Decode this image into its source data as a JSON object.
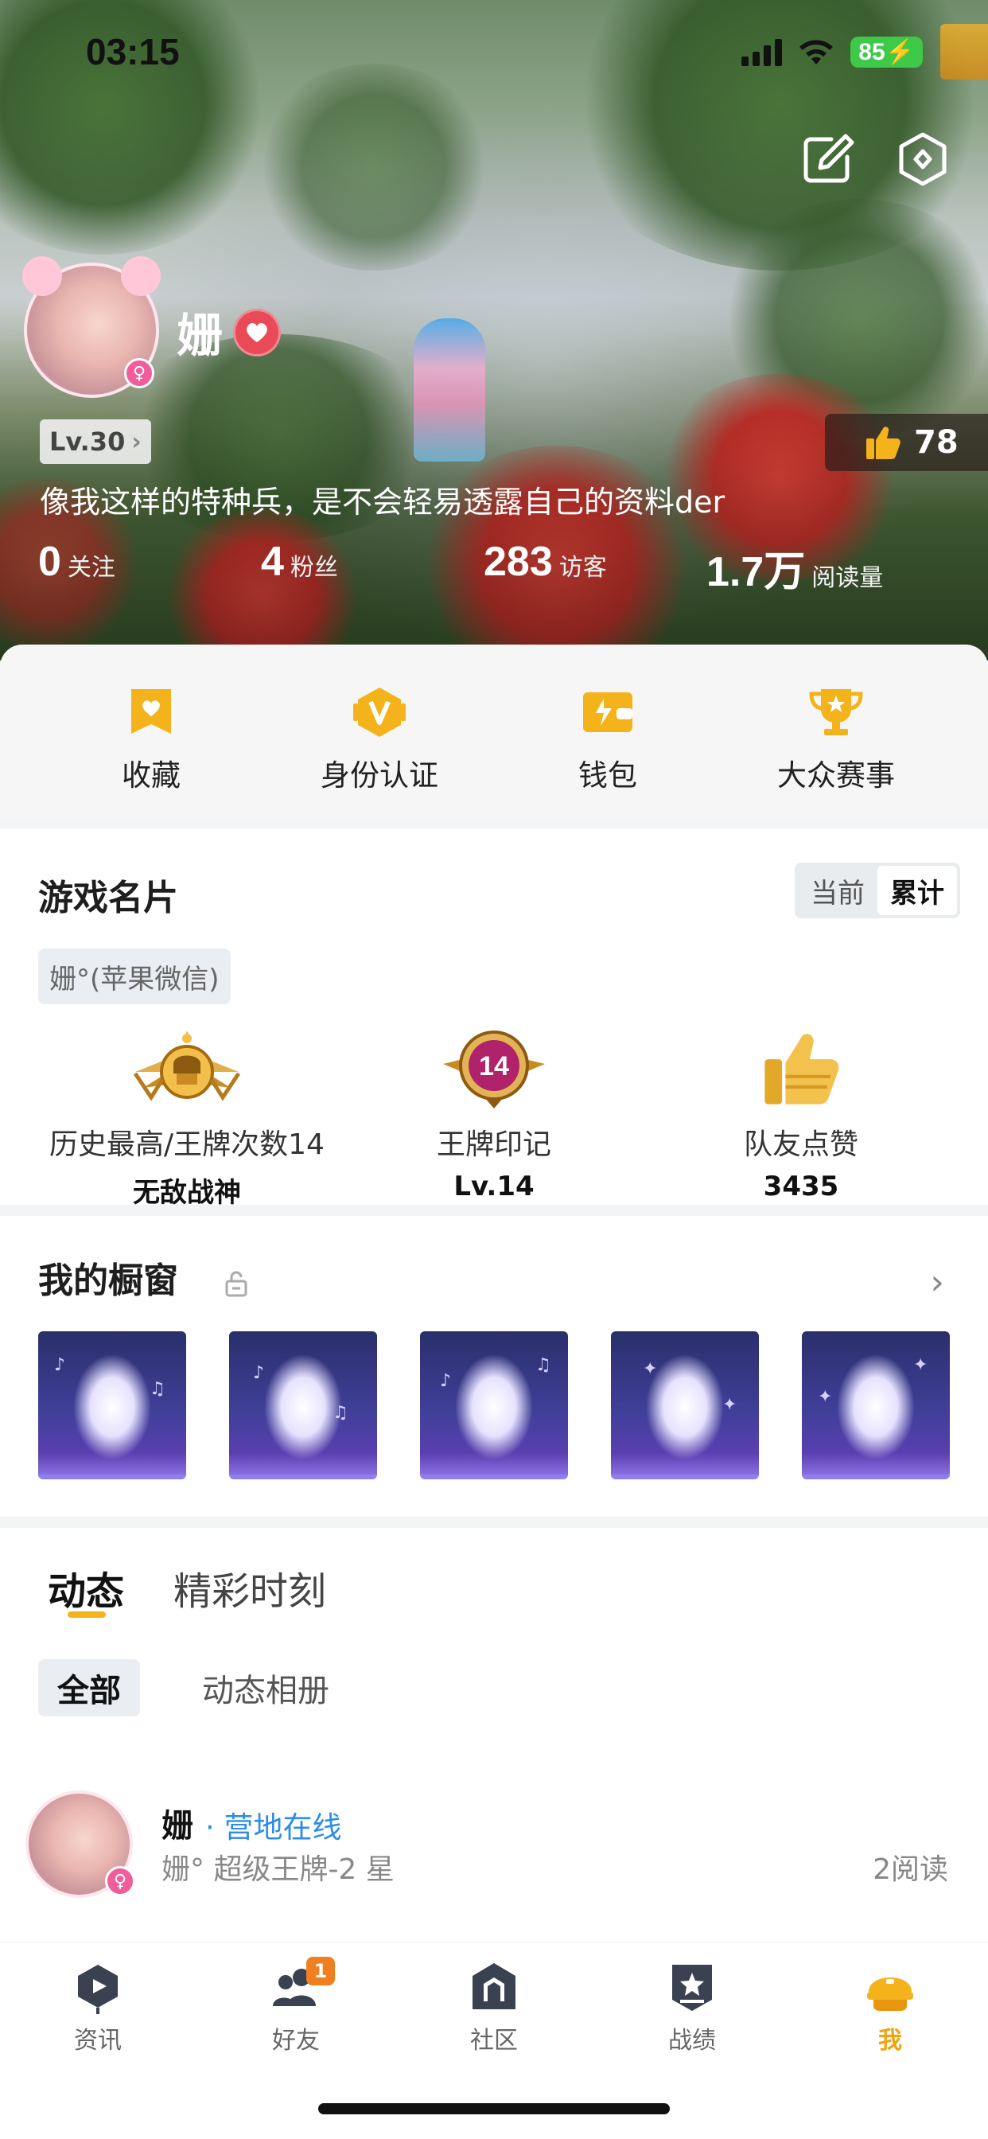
{
  "status_bar": {
    "time": "03:15",
    "battery": "85"
  },
  "profile": {
    "nickname": "姗",
    "gender_symbol": "♀",
    "level": "Lv.30",
    "likes": "78",
    "bio": "像我这样的特种兵，是不会轻易透露自己的资料der",
    "stats": [
      {
        "value": "0",
        "label": "关注"
      },
      {
        "value": "4",
        "label": "粉丝"
      },
      {
        "value": "283",
        "label": "访客"
      },
      {
        "value": "1.7万",
        "label": "阅读量"
      }
    ]
  },
  "quick_menu": [
    {
      "label": "收藏",
      "icon": "bookmark-icon"
    },
    {
      "label": "身份认证",
      "icon": "verify-icon"
    },
    {
      "label": "钱包",
      "icon": "wallet-icon"
    },
    {
      "label": "大众赛事",
      "icon": "trophy-icon"
    }
  ],
  "game_card": {
    "title": "游戏名片",
    "toggle": {
      "current": "当前",
      "total": "累计",
      "selected": "total"
    },
    "account": "姗°(苹果微信)",
    "honors": [
      {
        "label": "历史最高/王牌次数14",
        "value": "无敌战神",
        "icon": "ace-medal-icon"
      },
      {
        "label": "王牌印记",
        "value": "Lv.14",
        "badge": "14",
        "icon": "ace-mark-icon"
      },
      {
        "label": "队友点赞",
        "value": "3435",
        "icon": "thumbs-up-icon"
      }
    ]
  },
  "showcase": {
    "title": "我的橱窗",
    "items_count": 5
  },
  "feed": {
    "tabs": [
      "动态",
      "精彩时刻"
    ],
    "active_tab": 0,
    "filters": [
      "全部",
      "动态相册"
    ],
    "post": {
      "author": "姗",
      "status": "· 营地在线",
      "meta": "姗°   超级王牌-2 星",
      "reads": "2阅读"
    }
  },
  "tabbar": [
    {
      "label": "资讯",
      "icon": "news-icon"
    },
    {
      "label": "好友",
      "icon": "friends-icon",
      "badge": "1"
    },
    {
      "label": "社区",
      "icon": "community-icon"
    },
    {
      "label": "战绩",
      "icon": "record-icon"
    },
    {
      "label": "我",
      "icon": "me-helmet-icon",
      "active": true
    }
  ],
  "colors": {
    "accent": "#f5b31b",
    "link": "#2d8ce6",
    "heart": "#e94a57",
    "battery": "#3ec948"
  }
}
